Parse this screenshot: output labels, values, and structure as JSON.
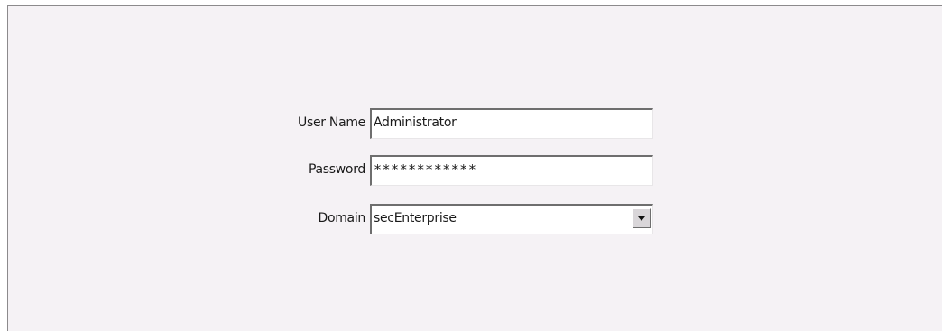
{
  "login_form": {
    "username": {
      "label": "User Name",
      "value": "Administrator"
    },
    "password": {
      "label": "Password",
      "value": "************"
    },
    "domain": {
      "label": "Domain",
      "selected": "secEnterprise",
      "dropdown_icon": "chevron-down-icon"
    }
  }
}
